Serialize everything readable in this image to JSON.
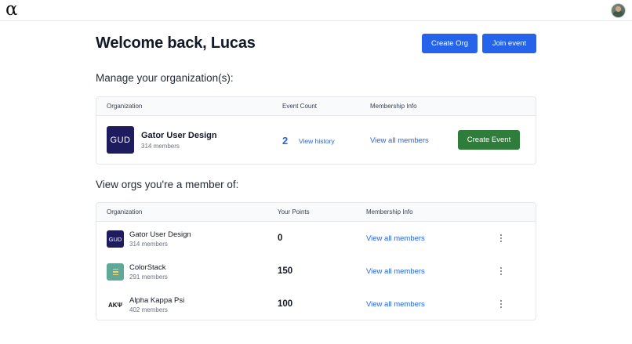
{
  "header": {
    "logo": "α",
    "avatar_icon": "user-avatar-icon"
  },
  "main": {
    "title": "Welcome back, Lucas",
    "create_org_label": "Create Org",
    "join_event_label": "Join event"
  },
  "manage": {
    "heading": "Manage your organization(s):",
    "columns": [
      "Organization",
      "Event Count",
      "Membership Info"
    ],
    "org": {
      "logo_text": "GUD",
      "name": "Gator User Design",
      "members": "314 members",
      "event_count": "2",
      "view_history": "View history",
      "view_all": "View all members",
      "create_event": "Create Event"
    }
  },
  "member": {
    "heading": "View orgs you're a member of:",
    "columns": [
      "Organization",
      "Your Points",
      "Membership Info"
    ],
    "rows": [
      {
        "logo_text": "GUD",
        "name": "Gator User Design",
        "members": "314 members",
        "points": "0",
        "view_all": "View all members"
      },
      {
        "logo_text": "",
        "name": "ColorStack",
        "members": "291 members",
        "points": "150",
        "view_all": "View all members"
      },
      {
        "logo_text": "ΑΚΨ",
        "name": "Alpha Kappa Psi",
        "members": "402 members",
        "points": "100",
        "view_all": "View all members"
      }
    ]
  },
  "colors": {
    "primary": "#2563eb",
    "create_event": "#2f7d3a",
    "gud_brand": "#1e1b5e",
    "colorstack_brand": "#5fa89a"
  }
}
